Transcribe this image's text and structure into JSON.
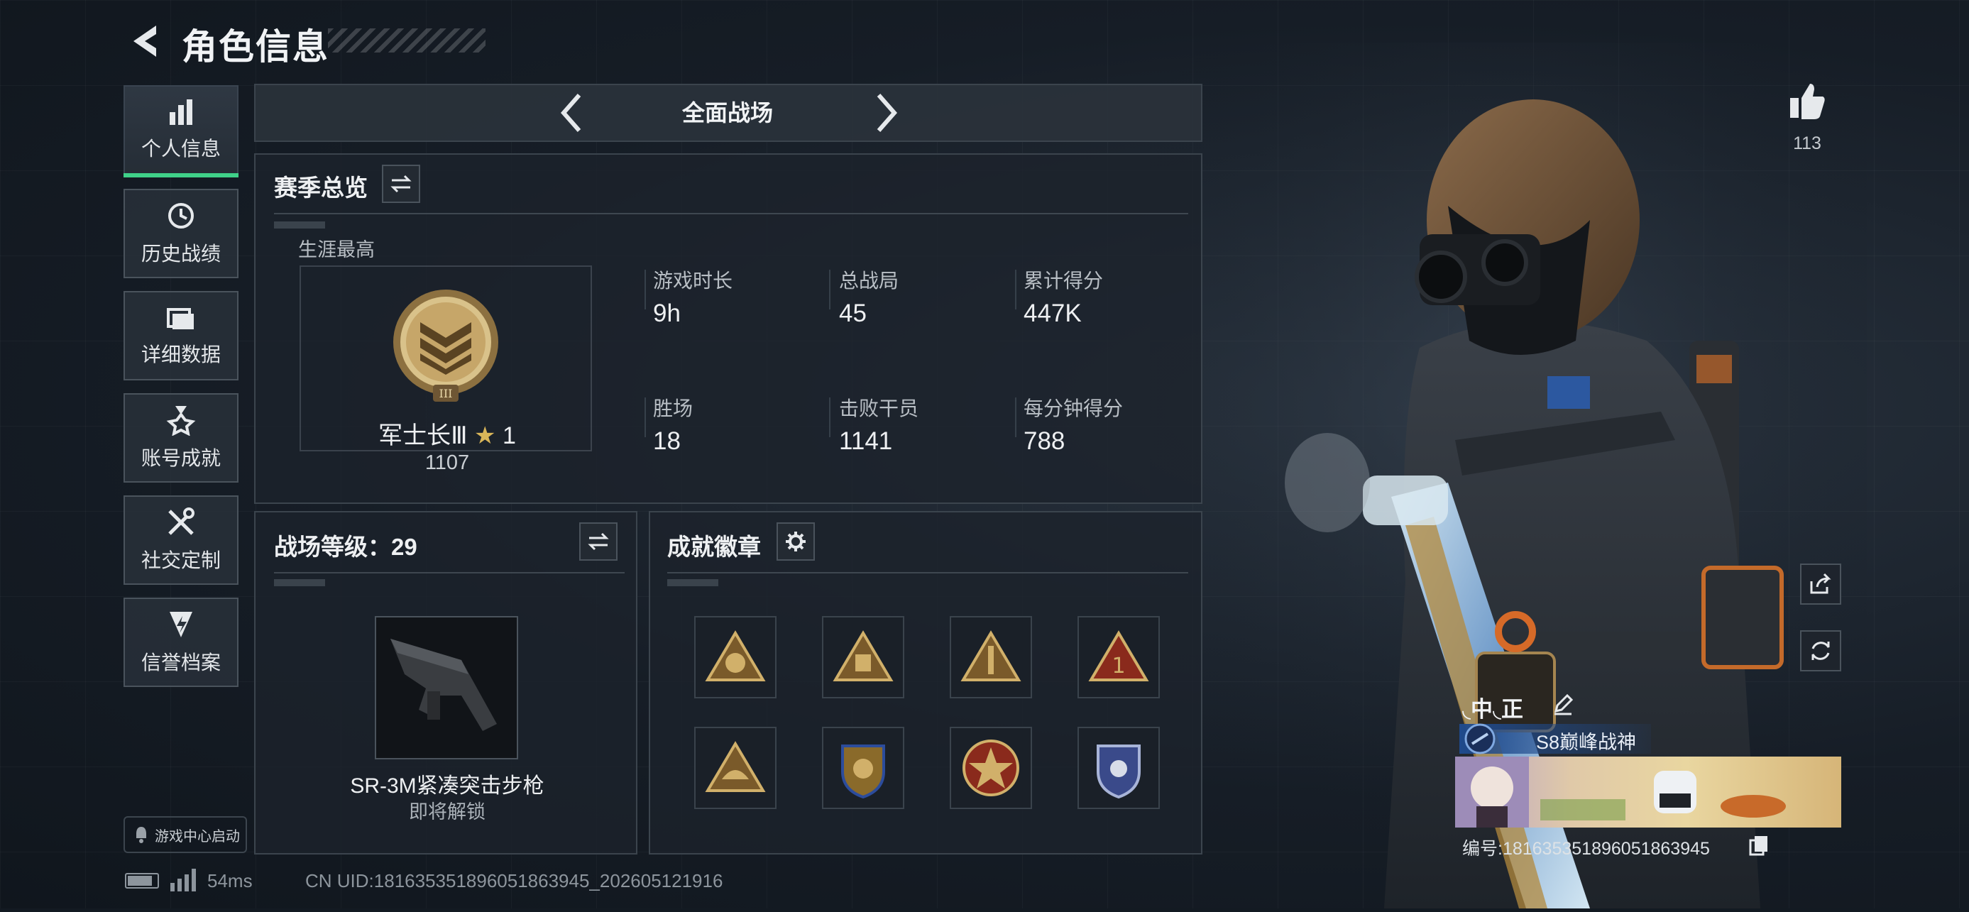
{
  "header": {
    "title": "角色信息"
  },
  "sidebar": {
    "items": [
      {
        "label": "个人信息"
      },
      {
        "label": "历史战绩"
      },
      {
        "label": "详细数据"
      },
      {
        "label": "账号成就"
      },
      {
        "label": "社交定制"
      },
      {
        "label": "信誉档案"
      }
    ],
    "game_center_label": "游戏中心启动"
  },
  "mode_selector": {
    "label": "全面战场"
  },
  "season": {
    "title": "赛季总览",
    "career_label": "生涯最高",
    "rank_name": "军士长Ⅲ",
    "rank_stars": "1",
    "rank_points": "1107",
    "stats": [
      {
        "label": "游戏时长",
        "value": "9h"
      },
      {
        "label": "总战局",
        "value": "45"
      },
      {
        "label": "累计得分",
        "value": "447K"
      },
      {
        "label": "胜场",
        "value": "18"
      },
      {
        "label": "击败干员",
        "value": "1141"
      },
      {
        "label": "每分钟得分",
        "value": "788"
      }
    ]
  },
  "battle_level": {
    "title": "战场等级：29",
    "weapon_name": "SR-3M紧凑突击步枪",
    "weapon_status": "即将解锁"
  },
  "badges": {
    "title": "成就徽章"
  },
  "profile": {
    "likes": "113",
    "player_name": "◟中◟正",
    "player_title": "S8巅峰战神",
    "player_id": "编号:1816353518960518639​45"
  },
  "status_bar": {
    "ping": "54ms",
    "uid": "CN UID:1816353518960518639​45_202605121916"
  },
  "colors": {
    "accent": "#3fd189",
    "gold": "#c9a35a",
    "panel": "#1c232b"
  }
}
